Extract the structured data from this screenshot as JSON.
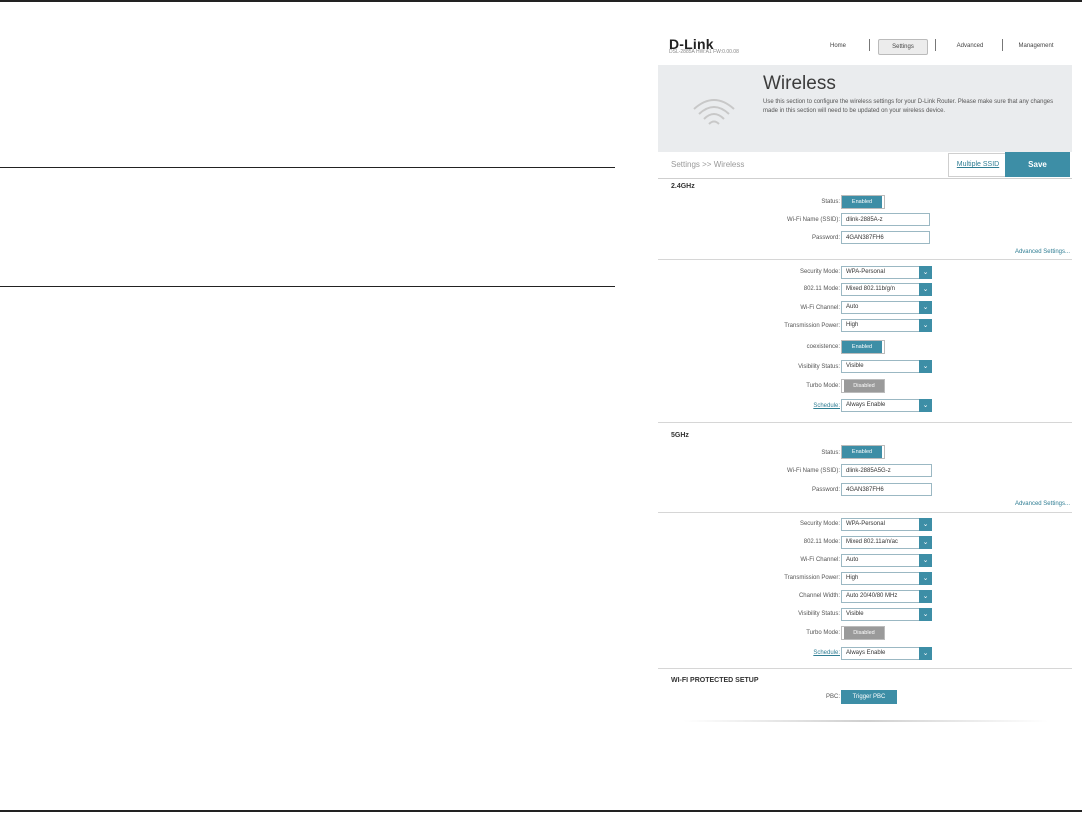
{
  "header": {
    "logo": "D-Link",
    "model": "DSL-2885A   HW:A1   FW:0.00.08",
    "nav": [
      {
        "label": "Home"
      },
      {
        "label": "Settings"
      },
      {
        "label": "Advanced"
      },
      {
        "label": "Management"
      }
    ]
  },
  "banner": {
    "title": "Wireless",
    "description": "Use this section to configure the wireless settings for your D-Link Router. Please make sure that any changes made in this section will need to be updated on your wireless device.",
    "icon": "wifi-icon"
  },
  "toolbar": {
    "breadcrumb": "Settings >> Wireless",
    "multiple_ssid": "Multiple SSID",
    "save": "Save"
  },
  "band24": {
    "title": "2.4GHz",
    "status_label": "Status:",
    "status_value": "Enabled",
    "ssid_label": "Wi-Fi Name (SSID):",
    "ssid_value": "dlink-2885A-z",
    "password_label": "Password:",
    "password_value": "4GAN387FH6",
    "advanced_link": "Advanced Settings...",
    "security_label": "Security Mode:",
    "security_value": "WPA-Personal",
    "mode_label": "802.11 Mode:",
    "mode_value": "Mixed 802.11b/g/n",
    "channel_label": "Wi-Fi Channel:",
    "channel_value": "Auto",
    "power_label": "Transmission Power:",
    "power_value": "High",
    "coexist_label": "coexistence:",
    "coexist_value": "Enabled",
    "visibility_label": "Visibility Status:",
    "visibility_value": "Visible",
    "turbo_label": "Turbo Mode:",
    "turbo_value": "Disabled",
    "schedule_label": "Schedule:",
    "schedule_value": "Always Enable"
  },
  "band5": {
    "title": "5GHz",
    "status_label": "Status:",
    "status_value": "Enabled",
    "ssid_label": "Wi-Fi Name (SSID):",
    "ssid_value": "dlink-2885A5G-z",
    "password_label": "Password:",
    "password_value": "4GAN387FH6",
    "advanced_link": "Advanced Settings...",
    "security_label": "Security Mode:",
    "security_value": "WPA-Personal",
    "mode_label": "802.11 Mode:",
    "mode_value": "Mixed 802.11a/n/ac",
    "channel_label": "Wi-Fi Channel:",
    "channel_value": "Auto",
    "power_label": "Transmission Power:",
    "power_value": "High",
    "width_label": "Channel Width:",
    "width_value": "Auto 20/40/80 MHz",
    "visibility_label": "Visibility Status:",
    "visibility_value": "Visible",
    "turbo_label": "Turbo Mode:",
    "turbo_value": "Disabled",
    "schedule_label": "Schedule:",
    "schedule_value": "Always Enable"
  },
  "wps": {
    "title": "WI-FI PROTECTED SETUP",
    "pbc_label": "PBC:",
    "pbc_button": "Trigger PBC"
  },
  "colors": {
    "accent": "#3d8ea6",
    "banner_bg": "#eaecee",
    "link": "#2f7d93"
  }
}
